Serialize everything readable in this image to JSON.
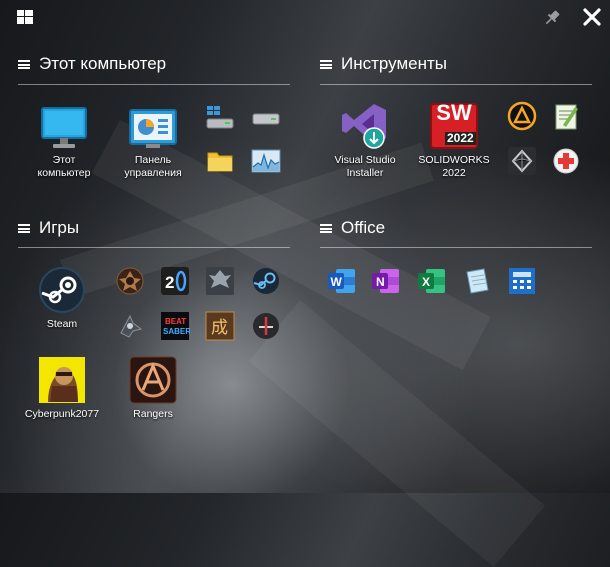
{
  "groups": {
    "computer": {
      "title": "Этот компьютер",
      "tiles": [
        {
          "label": "Этот компьютер",
          "icon": "monitor-icon"
        },
        {
          "label": "Панель управления",
          "icon": "control-panel-icon"
        }
      ],
      "small_icons": [
        "drive-icon",
        "drive-icon",
        "folder-icon",
        "resource-monitor-icon"
      ]
    },
    "tools": {
      "title": "Инструменты",
      "tiles": [
        {
          "label": "Visual Studio Installer",
          "icon": "visual-studio-installer-icon"
        },
        {
          "label": "SOLIDWORKS 2022",
          "icon": "solidworks-icon",
          "badge": "2022",
          "logo": "SW"
        }
      ],
      "small_icons": [
        "aimp-icon",
        "notepad-icon",
        "unity-icon",
        "health-icon"
      ]
    },
    "games": {
      "title": "Игры",
      "tiles": [
        {
          "label": "Steam",
          "icon": "steam-icon"
        },
        {
          "label": "Cyberpunk2077",
          "icon": "cyberpunk-icon"
        },
        {
          "label": "Rangers",
          "icon": "rangers-icon"
        }
      ],
      "small_icons": [
        "game-emblem-icon",
        "portal2-icon",
        "skyrim-icon",
        "steam-icon",
        "spaceship-icon",
        "beat-saber-icon",
        "kanji-game-icon",
        "sword-game-icon"
      ],
      "beat_saber_text": [
        "BEAT",
        "SABER"
      ],
      "kanji": "成"
    },
    "office": {
      "title": "Office",
      "small_icons": [
        "word-icon",
        "onenote-icon",
        "excel-icon",
        "notepad-alt-icon",
        "calculator-icon"
      ],
      "letters": {
        "word": "W",
        "onenote": "N",
        "excel": "X"
      }
    }
  },
  "colors": {
    "accent_steam": "#1b2838",
    "word": "#2b579a",
    "onenote": "#7719aa",
    "excel": "#217346",
    "solidworks": "#d71f26"
  }
}
